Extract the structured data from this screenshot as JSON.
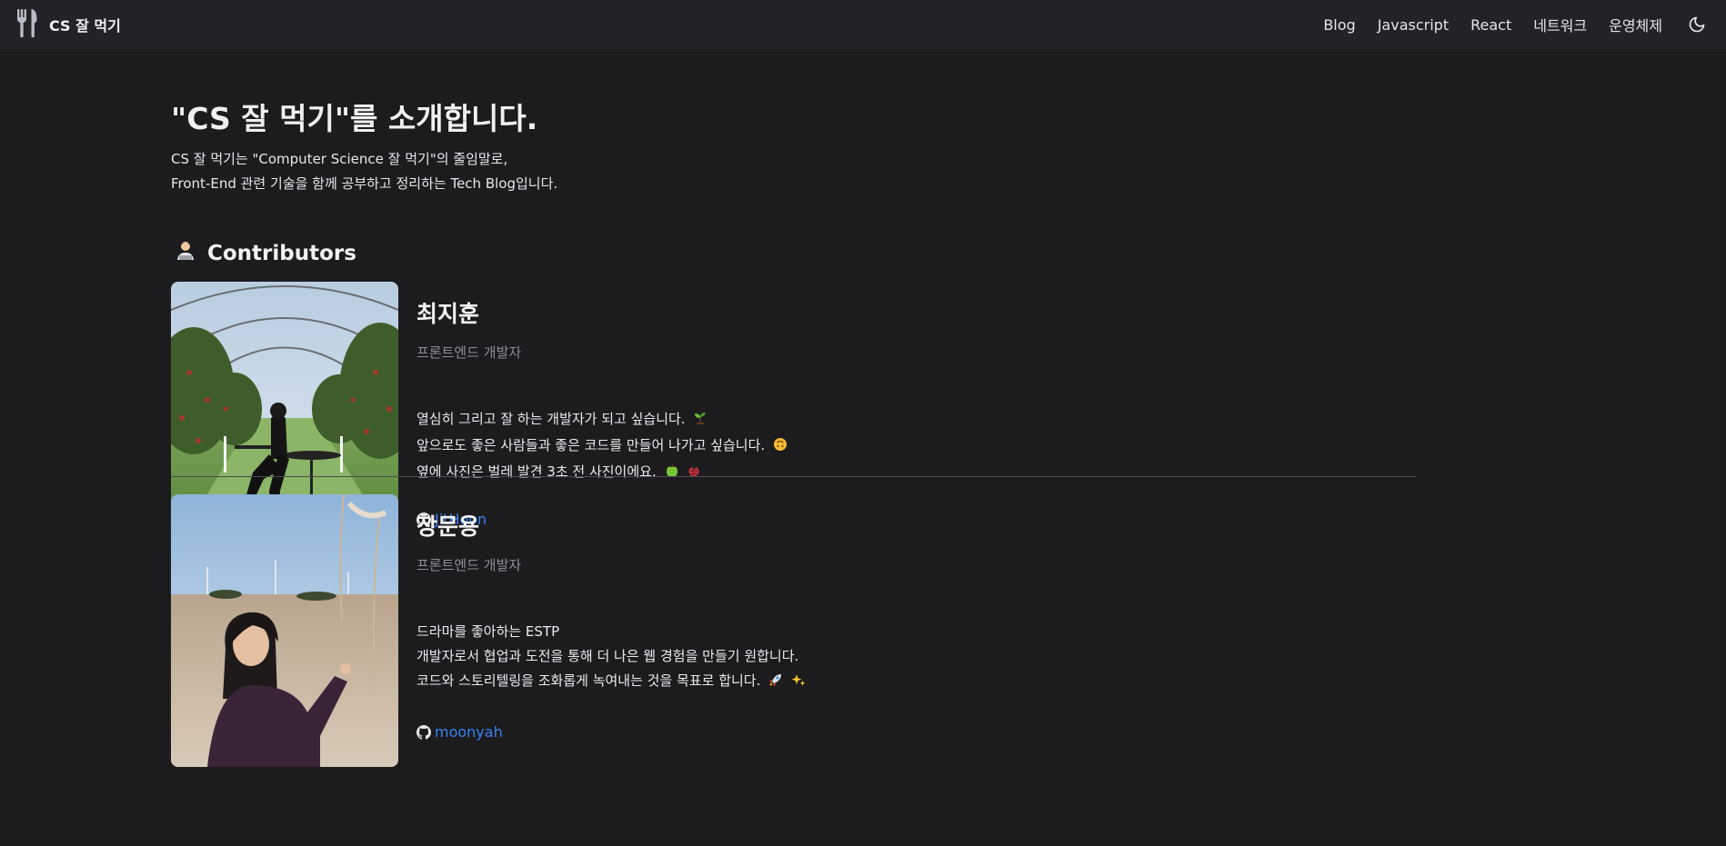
{
  "nav": {
    "brand_title": "CS 잘 먹기",
    "brand_icon": "utensils-icon",
    "links": [
      "Blog",
      "Javascript",
      "React",
      "네트워크",
      "운영체제"
    ],
    "theme_icon": "moon-icon"
  },
  "page": {
    "title": "\"CS 잘 먹기\"를 소개합니다.",
    "intro_line1": "CS 잘 먹기는 \"Computer Science 잘 먹기\"의 줄임말로,",
    "intro_line2": "Front-End 관련 기술을 함께 공부하고 정리하는 Tech Blog입니다.",
    "contributors_heading": "Contributors",
    "contributors_icon": "technologist-emoji"
  },
  "contributors": [
    {
      "name": "최지훈",
      "role": "프론트엔드 개발자",
      "bio_line1": "열심히 그리고 잘 하는 개발자가 되고 싶습니다.",
      "bio_line2": "앞으로도 좋은 사람들과 좋은 코드를 만들어 나가고 싶습니다.",
      "bio_line3": "옆에 사진은 벌레 발견 3초 전 사진이에요.",
      "github": "JitHoon",
      "icons": [
        "seedling-emoji",
        "upside-down-face-emoji",
        "green-apple-emoji",
        "ladybug-emoji"
      ]
    },
    {
      "name": "장문용",
      "role": "프론트엔드 개발자",
      "bio_line1": "드라마를 좋아하는 ESTP",
      "bio_line2": "개발자로서 협업과 도전을 통해 더 나은 웹 경험을 만들기 원합니다.",
      "bio_line3": "코드와 스토리텔링을 조화롭게 녹여내는 것을 목표로 합니다.",
      "github": "moonyah",
      "icons": [
        "rocket-emoji",
        "sparkles-emoji"
      ]
    }
  ],
  "colors": {
    "background": "#1c1c1f",
    "navbar": "#222326",
    "link": "#3b82f6",
    "muted": "#8e8e95"
  }
}
